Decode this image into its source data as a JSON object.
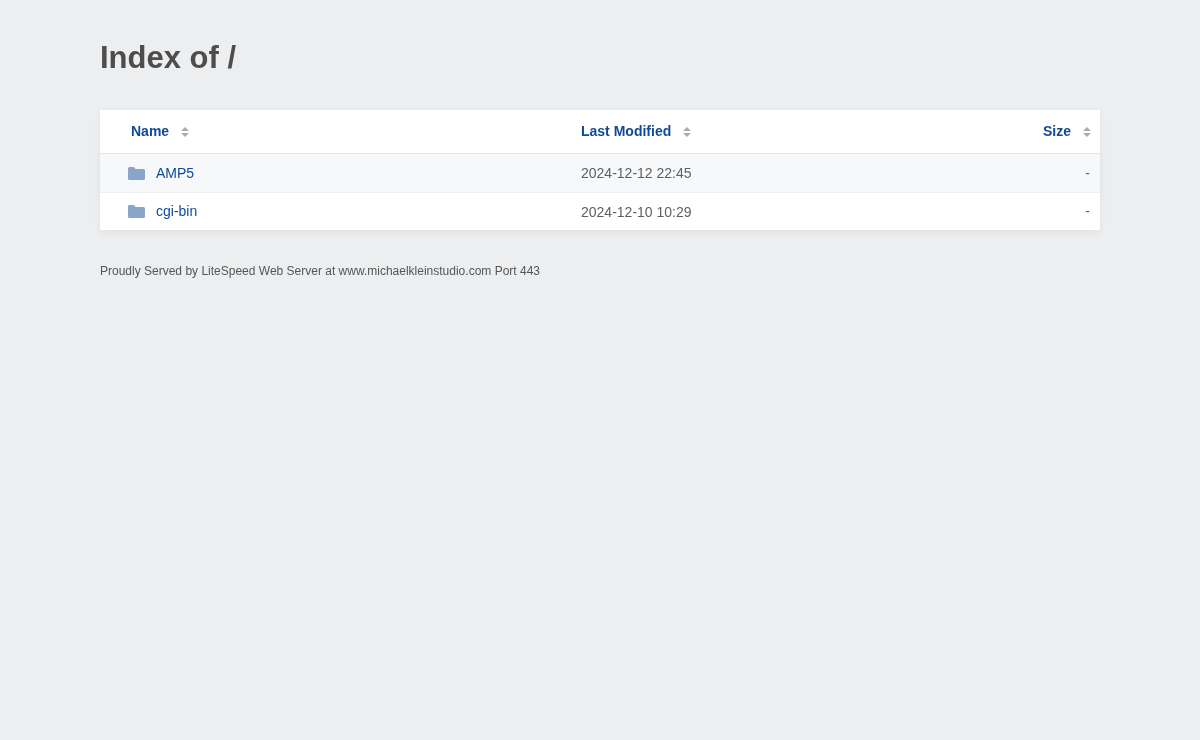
{
  "title": "Index of /",
  "table": {
    "columns": [
      {
        "label": "Name"
      },
      {
        "label": "Last Modified"
      },
      {
        "label": "Size"
      }
    ],
    "rows": [
      {
        "kind": "folder",
        "name": "AMP5",
        "last_modified": "2024-12-12 22:45",
        "size": "-"
      },
      {
        "kind": "folder",
        "name": "cgi-bin",
        "last_modified": "2024-12-10 10:29",
        "size": "-"
      }
    ]
  },
  "footer": "Proudly Served by LiteSpeed Web Server at www.michaelkleinstudio.com Port 443"
}
